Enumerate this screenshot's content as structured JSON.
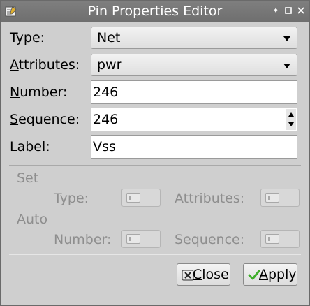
{
  "window": {
    "title": "Pin Properties Editor"
  },
  "fields": {
    "type_label_mnemonic": "T",
    "type_label_rest": "ype:",
    "type_value": "Net",
    "attributes_label_mnemonic": "A",
    "attributes_label_rest": "ttributes:",
    "attributes_value": "pwr",
    "number_label_mnemonic": "N",
    "number_label_rest": "umber:",
    "number_value": "246",
    "sequence_label_mnemonic": "S",
    "sequence_label_rest": "equence:",
    "sequence_value": "246",
    "label_label_mnemonic": "L",
    "label_label_rest": "abel:",
    "label_value": "Vss"
  },
  "set_section": {
    "heading": "Set",
    "type_label": "Type:",
    "attributes_label": "Attributes:"
  },
  "auto_section": {
    "heading": "Auto",
    "number_label": "Number:",
    "sequence_label": "Sequence:"
  },
  "buttons": {
    "close_mnemonic": "C",
    "close_rest": "lose",
    "apply_mnemonic": "A",
    "apply_rest": "pply"
  },
  "icons": {
    "app": "editor-app-icon",
    "pin_window": "pin-icon",
    "maximize": "maximize-icon",
    "close": "close-icon",
    "close_button": "clear-x-icon",
    "apply_button": "checkmark-icon"
  },
  "colors": {
    "titlebar": "#777777",
    "window_bg": "#cfcfcf",
    "disabled_text": "#8e8e8e",
    "checkmark": "#3fae2a"
  }
}
